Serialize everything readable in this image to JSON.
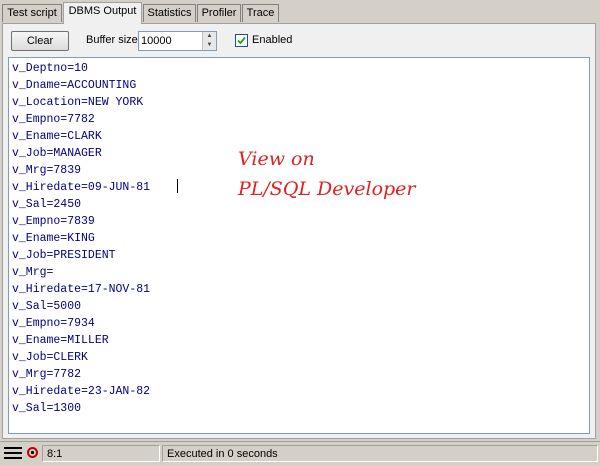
{
  "tabs": [
    {
      "label": "Test script"
    },
    {
      "label": "DBMS Output",
      "active": true
    },
    {
      "label": "Statistics"
    },
    {
      "label": "Profiler"
    },
    {
      "label": "Trace"
    }
  ],
  "toolbar": {
    "clear_label": "Clear",
    "buffer_label": "Buffer size",
    "buffer_value": "10000",
    "enabled_label": "Enabled",
    "enabled_checked": true
  },
  "output": {
    "lines": [
      "v_Deptno=10",
      "v_Dname=ACCOUNTING",
      "v_Location=NEW YORK",
      "v_Empno=7782",
      "v_Ename=CLARK",
      "v_Job=MANAGER",
      "v_Mrg=7839",
      "v_Hiredate=09-JUN-81",
      "v_Sal=2450",
      "v_Empno=7839",
      "v_Ename=KING",
      "v_Job=PRESIDENT",
      "v_Mrg=",
      "v_Hiredate=17-NOV-81",
      "v_Sal=5000",
      "v_Empno=7934",
      "v_Ename=MILLER",
      "v_Job=CLERK",
      "v_Mrg=7782",
      "v_Hiredate=23-JAN-82",
      "v_Sal=1300"
    ]
  },
  "annotation": {
    "line1": "View on",
    "line2": "PL/SQL Developer"
  },
  "status": {
    "position": "8:1",
    "message": "Executed in 0 seconds"
  },
  "colors": {
    "output_text": "#000080",
    "annotation": "#e02020"
  }
}
